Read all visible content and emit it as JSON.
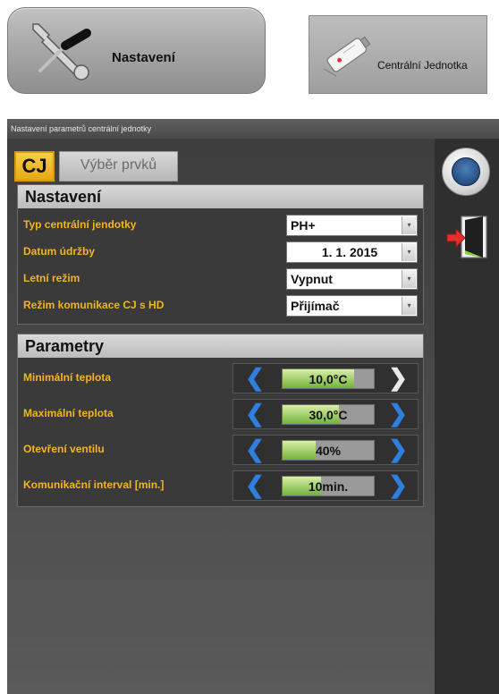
{
  "top_buttons": {
    "settings_label": "Nastavení",
    "central_label": "Centrální Jednotka",
    "settings_icon": "wrench-screwdriver-icon",
    "central_icon": "usb-device-icon"
  },
  "window": {
    "title": "Nastavení parametrů centrální jednotky"
  },
  "tabs": [
    {
      "label": "CJ",
      "active": true
    },
    {
      "label": "Výběr prvků",
      "active": false
    }
  ],
  "settings_panel": {
    "title": "Nastavení",
    "rows": [
      {
        "label": "Typ centrální jendotky",
        "value": "PH+"
      },
      {
        "label": "Datum údržby",
        "value": "1. 1. 2015"
      },
      {
        "label": "Letní režim",
        "value": "Vypnut"
      },
      {
        "label": "Režim komunikace CJ s HD",
        "value": "Přijímač"
      }
    ]
  },
  "params_panel": {
    "title": "Parametry",
    "rows": [
      {
        "label": "Minimální teplota",
        "value": "10,0°C",
        "fill": 0.78
      },
      {
        "label": "Maximální teplota",
        "value": "30,0°C",
        "fill": 0.62
      },
      {
        "label": "Otevření ventilu",
        "value": "40%",
        "fill": 0.36
      },
      {
        "label": "Komunikační interval [min.]",
        "value": "10min.",
        "fill": 0.42
      }
    ]
  },
  "icons": {
    "clock": "clock-icon",
    "exit": "exit-door-icon"
  },
  "colors": {
    "accent_orange": "#f3b51c",
    "chevron_blue": "#2d7fe0",
    "bar_green": "#74b13a"
  }
}
